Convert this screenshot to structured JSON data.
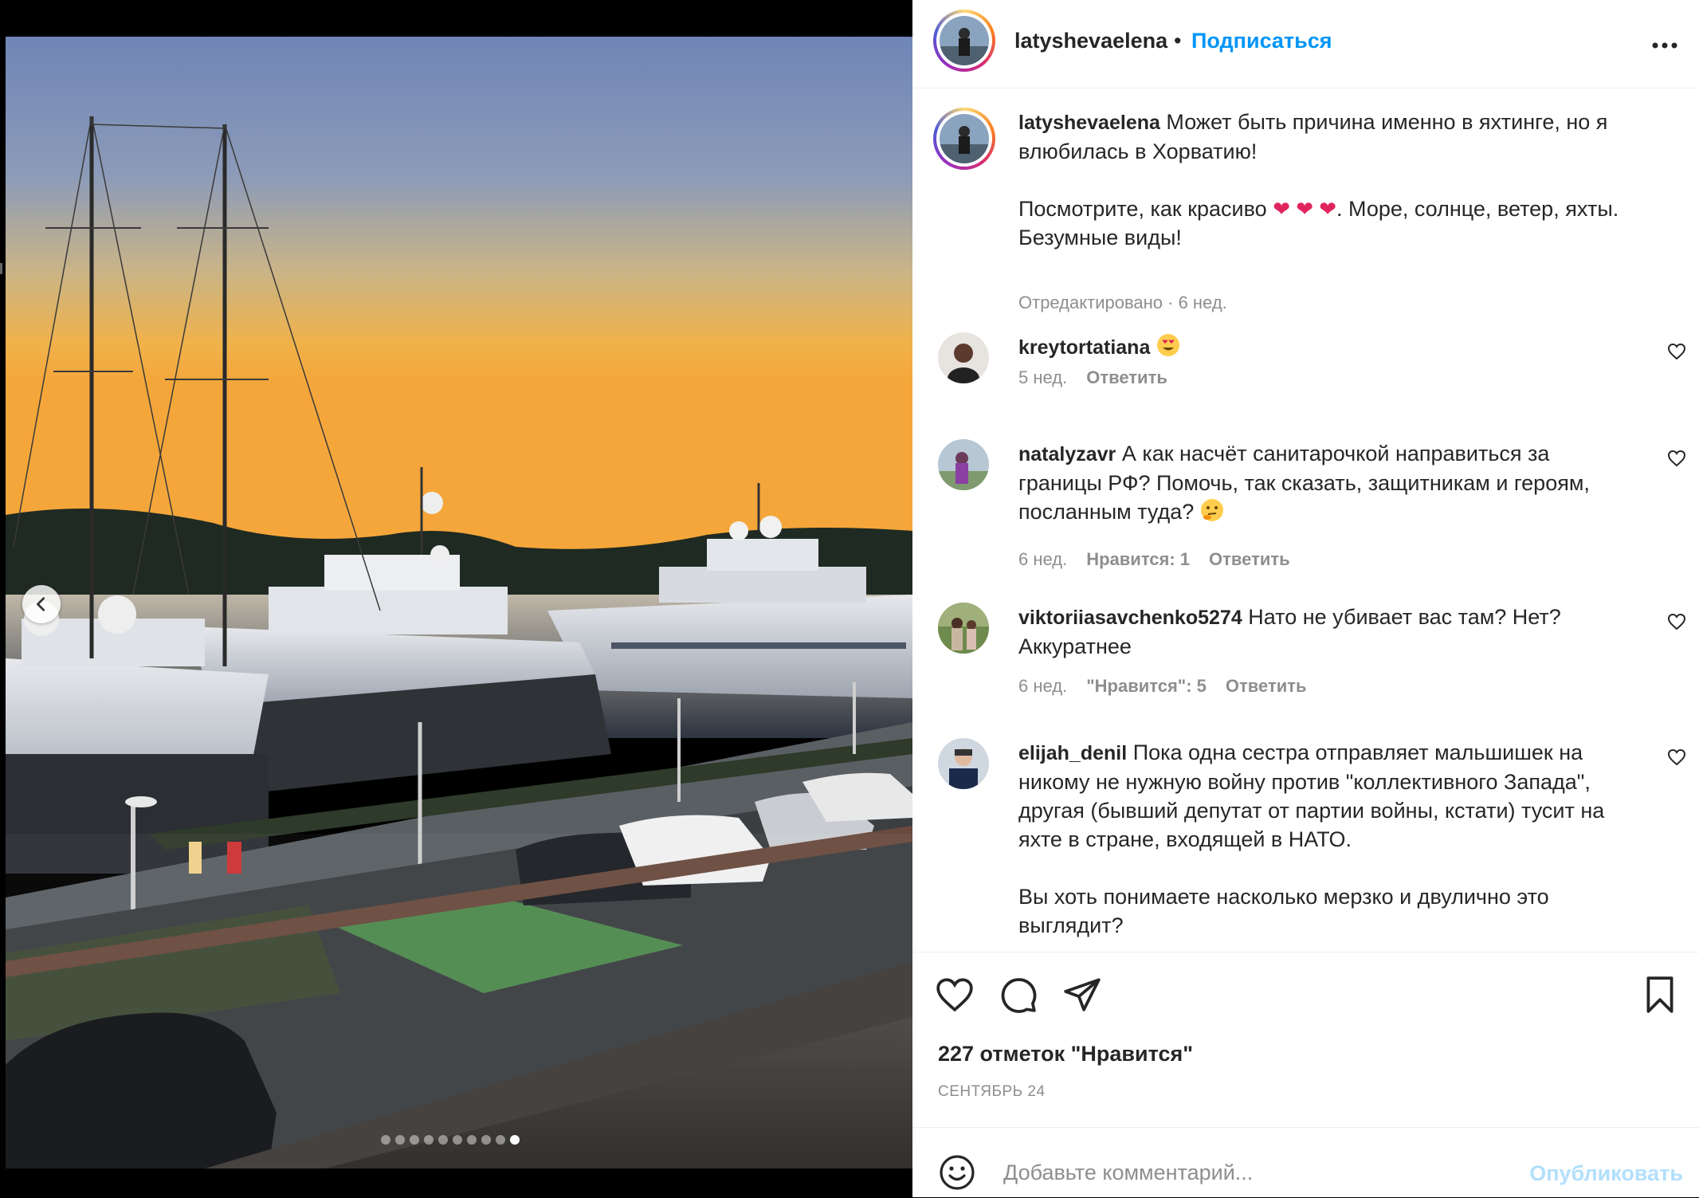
{
  "photo": {
    "carousel_dot_count": 10,
    "active_dot_index": 9
  },
  "header": {
    "username": "latyshevaelena",
    "separator": "•",
    "follow_label": "Подписаться",
    "more_label": "•••"
  },
  "caption": {
    "username": "latyshevaelena",
    "text_line1": "Может быть причина именно в яхтинге, но я",
    "text_line2": "влюбилась в Хорватию!",
    "text_line3_a": "Посмотрите, как красиво",
    "emoji_hearts": "❤️ ❤️ ❤️",
    "text_line3_b": ". Море, солнце, ветер, яхты.",
    "text_line4": "Безумные виды!",
    "meta": "Отредактировано · 6 нед."
  },
  "comments": [
    {
      "username": "kreytortatiana",
      "text": "",
      "emoji": "😍",
      "time": "5 нед.",
      "likes": "",
      "reply": "Ответить"
    },
    {
      "username": "natalyzavr",
      "text_lines": [
        "А как насчёт санитарочкой направиться за",
        "границы РФ? Помочь, так сказать, защитникам и героям,",
        "посланным туда?"
      ],
      "emoji": "🤔",
      "time": "6 нед.",
      "likes": "Нравится: 1",
      "reply": "Ответить"
    },
    {
      "username": "viktoriiasavchenko5274",
      "text_lines": [
        "Нато не убивает вас там? Нет?",
        "Аккуратнее"
      ],
      "time": "6 нед.",
      "likes": "\"Нравится\": 5",
      "reply": "Ответить"
    },
    {
      "username": "elijah_denil",
      "text_lines": [
        "Пока одна сестра отправляет мальшишек на",
        "никому не нужную войну против \"коллективного Запада\",",
        "другая (бывший депутат от партии войны, кстати) тусит на",
        "яхте в стране, входящей в НАТО.",
        "",
        "Вы хоть понимаете насколько мерзко и двулично это",
        "выглядит?"
      ]
    }
  ],
  "actions": {
    "likes_text": "227 отметок \"Нравится\"",
    "date": "СЕНТЯБРЬ 24"
  },
  "add_comment": {
    "placeholder": "Добавьте комментарий...",
    "publish_label": "Опубликовать"
  },
  "colors": {
    "accent": "#0095f6",
    "publish_disabled": "#b2dffc",
    "muted": "#8e8e8e",
    "text": "#262626"
  }
}
